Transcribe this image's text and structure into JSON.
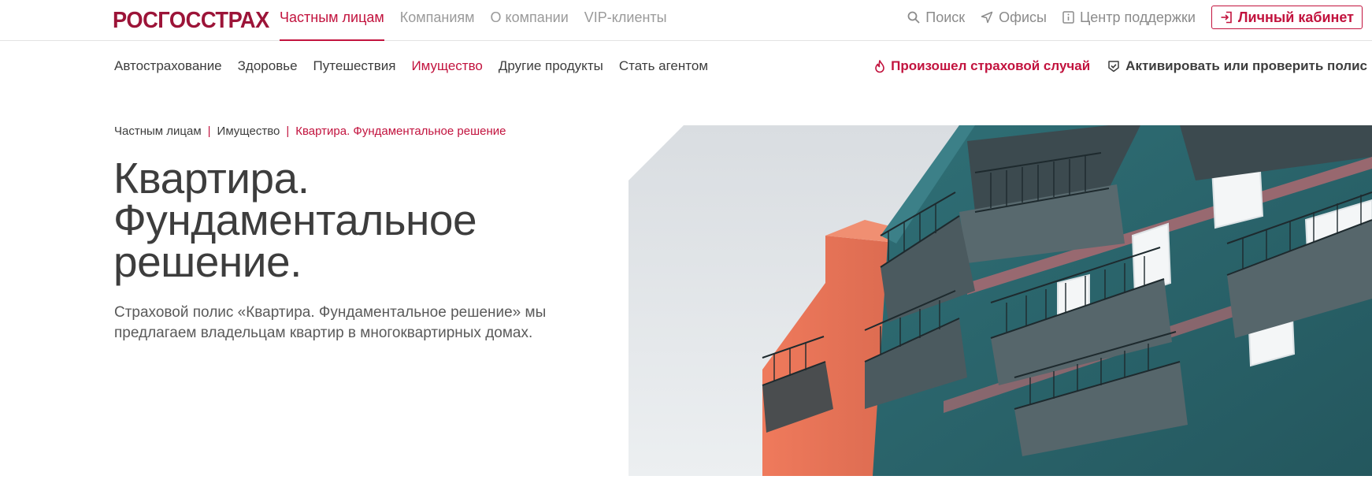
{
  "brand": {
    "logo_text": "РОСГОССТРАХ",
    "color": "#9c1438",
    "accent": "#c2133e"
  },
  "top_nav": {
    "segments": [
      {
        "label": "Частным лицам",
        "active": true
      },
      {
        "label": "Компаниям",
        "active": false
      },
      {
        "label": "О компании",
        "active": false
      },
      {
        "label": "VIP-клиенты",
        "active": false
      }
    ],
    "tools": [
      {
        "label": "Поиск",
        "icon": "search-icon"
      },
      {
        "label": "Офисы",
        "icon": "location-arrow-icon"
      },
      {
        "label": "Центр поддержки",
        "icon": "info-icon"
      }
    ],
    "cabinet_label": "Личный кабинет",
    "cabinet_icon": "login-icon"
  },
  "sub_nav": {
    "items": [
      {
        "label": "Автострахование",
        "active": false
      },
      {
        "label": "Здоровье",
        "active": false
      },
      {
        "label": "Путешествия",
        "active": false
      },
      {
        "label": "Имущество",
        "active": true
      },
      {
        "label": "Другие продукты",
        "active": false
      },
      {
        "label": "Стать агентом",
        "active": false
      }
    ],
    "insured_event": {
      "label": "Произошел страховой случай",
      "icon": "flame-icon"
    },
    "activate_policy": {
      "label": "Активировать или проверить полис",
      "icon": "check-shield-icon"
    }
  },
  "breadcrumb": [
    "Частным лицам",
    "Имущество",
    "Квартира. Фундаментальное решение"
  ],
  "hero": {
    "title_lines": [
      "Квартира.",
      "Фундаментальное",
      "решение."
    ],
    "description": "Страховой полис «Квартира. Фундаментальное решение» мы предлагаем владельцам квартир в многоквартирных домах.",
    "image_subject": "apartment-building-balconies-photo"
  }
}
